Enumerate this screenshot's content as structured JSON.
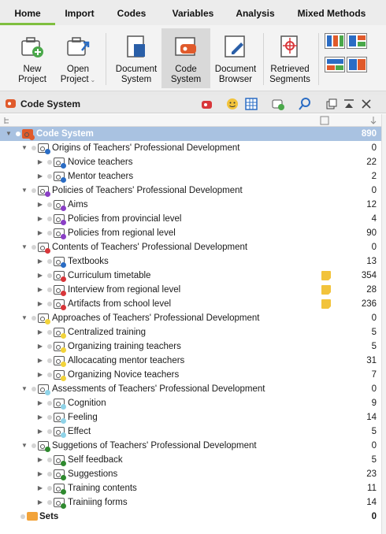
{
  "menu": {
    "tabs": [
      "Home",
      "Import",
      "Codes",
      "Variables",
      "Analysis",
      "Mixed Methods"
    ],
    "active": "Home"
  },
  "ribbon": {
    "new_project": "New\nProject",
    "open_project": "Open\nProject",
    "document_system": "Document\nSystem",
    "code_system": "Code\nSystem",
    "document_browser": "Document\nBrowser",
    "retrieved_segments": "Retrieved\nSegments"
  },
  "panel": {
    "title": "Code System"
  },
  "tree": [
    {
      "level": 0,
      "name": "Code System",
      "count": "890",
      "dot": "#e05a2b",
      "root": true
    },
    {
      "level": 1,
      "name": "Origins of Teachers' Professional Development",
      "count": "0",
      "dot": "#2a6cc4"
    },
    {
      "level": 2,
      "name": "Novice teachers",
      "count": "22",
      "dot": "#2a6cc4"
    },
    {
      "level": 2,
      "name": "Mentor teachers",
      "count": "2",
      "dot": "#2a6cc4"
    },
    {
      "level": 1,
      "name": "Policies of Teachers' Professional Development",
      "count": "0",
      "dot": "#8a3fc6"
    },
    {
      "level": 2,
      "name": "Aims",
      "count": "12",
      "dot": "#8a3fc6"
    },
    {
      "level": 2,
      "name": "Policies from provincial level",
      "count": "4",
      "dot": "#8a3fc6"
    },
    {
      "level": 2,
      "name": "Policies from regional level",
      "count": "90",
      "dot": "#8a3fc6"
    },
    {
      "level": 1,
      "name": "Contents of Teachers' Professional Development",
      "count": "0",
      "dot": "#d8363a"
    },
    {
      "level": 2,
      "name": "Textbooks",
      "count": "13",
      "dot": "#2a6cc4"
    },
    {
      "level": 2,
      "name": "Curriculum timetable",
      "count": "354",
      "dot": "#d8363a",
      "memo": true
    },
    {
      "level": 2,
      "name": "Interview from regional level",
      "count": "28",
      "dot": "#d8363a",
      "memo": true
    },
    {
      "level": 2,
      "name": "Artifacts from school level",
      "count": "236",
      "dot": "#d8363a",
      "memo": true
    },
    {
      "level": 1,
      "name": "Approaches of Teachers' Professional Development",
      "count": "0",
      "dot": "#f2d33a"
    },
    {
      "level": 2,
      "name": "Centralized training",
      "count": "5",
      "dot": "#f2d33a"
    },
    {
      "level": 2,
      "name": "Organizing training teachers",
      "count": "5",
      "dot": "#f2d33a"
    },
    {
      "level": 2,
      "name": "Allocacating mentor teachers",
      "count": "31",
      "dot": "#f2d33a"
    },
    {
      "level": 2,
      "name": "Organizing Novice teachers",
      "count": "7",
      "dot": "#f2d33a"
    },
    {
      "level": 1,
      "name": "Assessments of Teachers' Professional Development",
      "count": "0",
      "dot": "#8fd3e8"
    },
    {
      "level": 2,
      "name": "Cognition",
      "count": "9",
      "dot": "#8fd3e8"
    },
    {
      "level": 2,
      "name": "Feeling",
      "count": "14",
      "dot": "#8fd3e8"
    },
    {
      "level": 2,
      "name": "Effect",
      "count": "5",
      "dot": "#8fd3e8"
    },
    {
      "level": 1,
      "name": "Suggetions of Teachers' Professional Development",
      "count": "0",
      "dot": "#2f8a2f"
    },
    {
      "level": 2,
      "name": "Self feedback",
      "count": "5",
      "dot": "#2f8a2f"
    },
    {
      "level": 2,
      "name": "Suggestions",
      "count": "23",
      "dot": "#2f8a2f"
    },
    {
      "level": 2,
      "name": "Training contents",
      "count": "11",
      "dot": "#2f8a2f"
    },
    {
      "level": 2,
      "name": "Trainiing forms",
      "count": "14",
      "dot": "#2f8a2f"
    },
    {
      "level": 0,
      "name": "Sets",
      "count": "0",
      "sets": true
    }
  ]
}
